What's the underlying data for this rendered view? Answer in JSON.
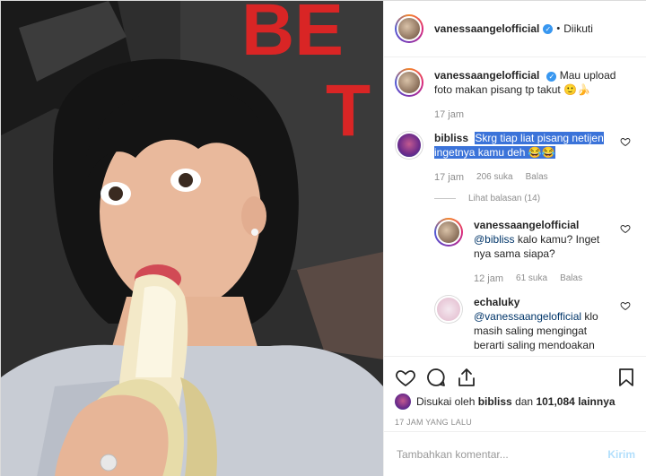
{
  "post": {
    "username": "vanessaangelofficial",
    "follow_status": "Diikuti",
    "caption_user": "vanessaangelofficial",
    "caption_text": "Mau upload foto makan pisang tp takut 🙂🍌",
    "caption_time": "17 jam"
  },
  "photo": {
    "poster_text_1": "BE",
    "poster_text_2": "T"
  },
  "comments": [
    {
      "user": "bibliss",
      "text": "Skrg tiap liat pisang netijen ingetnya kamu deh 😂😂",
      "time": "17 jam",
      "likes": "206 suka",
      "reply_label": "Balas",
      "view_replies": "Lihat balasan (14)"
    }
  ],
  "replies": [
    {
      "user": "vanessaangelofficial",
      "mention": "@bibliss",
      "text": "kalo kamu? Inget nya sama siapa?",
      "time": "12 jam",
      "likes": "61 suka",
      "reply_label": "Balas"
    },
    {
      "user": "echaluky",
      "mention": "@vanessaangelofficial",
      "text": "klo masih saling mengingat berarti saling mendoakan"
    }
  ],
  "likes_summary": {
    "prefix": "Disukai oleh",
    "user": "bibliss",
    "middle": "dan",
    "count": "101,084",
    "suffix": "lainnya"
  },
  "timestamp": "17 JAM YANG LALU",
  "comment_box": {
    "placeholder": "Tambahkan komentar...",
    "send_label": "Kirim"
  },
  "colors": {
    "verified": "#3897f0",
    "highlight": "#3b73d9",
    "send_disabled": "#b2dffc"
  }
}
